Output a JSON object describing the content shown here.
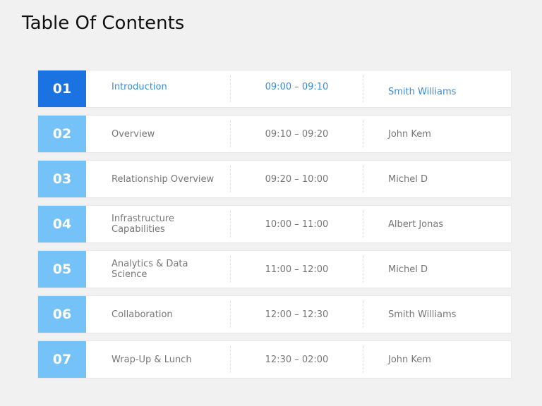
{
  "page": {
    "title": "Table Of Contents"
  },
  "colors": {
    "active_number_bg": "#1a73e1",
    "number_bg": "#74c2f7",
    "active_text": "#3c8bd6",
    "text": "#777777"
  },
  "agenda": [
    {
      "number": "01",
      "topic": "Introduction",
      "time": "09:00 – 09:10",
      "speaker": "Smith Williams",
      "active": true
    },
    {
      "number": "02",
      "topic": "Overview",
      "time": "09:10 – 09:20",
      "speaker": "John Kem",
      "active": false
    },
    {
      "number": "03",
      "topic": "Relationship Overview",
      "time": "09:20 – 10:00",
      "speaker": "Michel D",
      "active": false
    },
    {
      "number": "04",
      "topic": "Infrastructure Capabilities",
      "time": "10:00 – 11:00",
      "speaker": "Albert Jonas",
      "active": false
    },
    {
      "number": "05",
      "topic": "Analytics & Data Science",
      "time": "11:00 – 12:00",
      "speaker": "Michel D",
      "active": false
    },
    {
      "number": "06",
      "topic": "Collaboration",
      "time": "12:00 – 12:30",
      "speaker": "Smith Williams",
      "active": false
    },
    {
      "number": "07",
      "topic": "Wrap-Up & Lunch",
      "time": "12:30 – 02:00",
      "speaker": "John Kem",
      "active": false
    }
  ]
}
